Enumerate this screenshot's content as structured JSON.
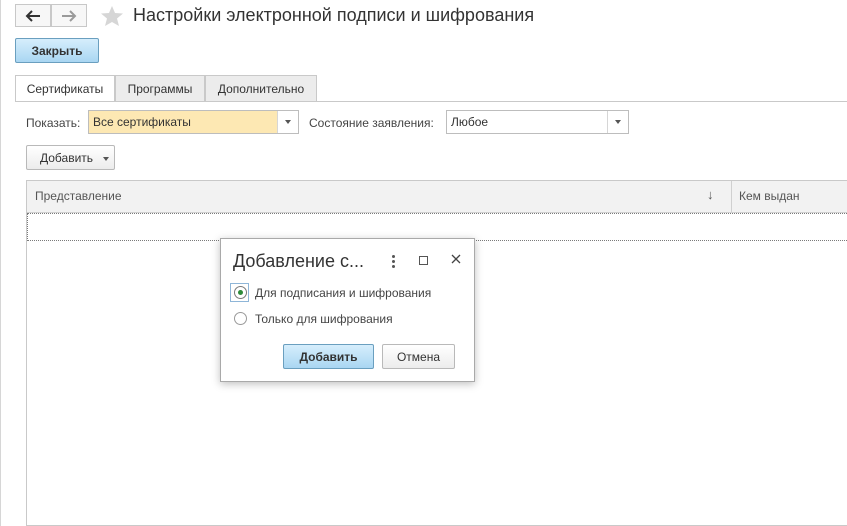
{
  "window": {
    "title": "Настройки электронной подписи и шифрования"
  },
  "toolbar": {
    "close_label": "Закрыть"
  },
  "tabs": [
    {
      "label": "Сертификаты",
      "active": true
    },
    {
      "label": "Программы",
      "active": false
    },
    {
      "label": "Дополнительно",
      "active": false
    }
  ],
  "filters": {
    "show_label": "Показать:",
    "show_value": "Все сертификаты",
    "status_label": "Состояние заявления:",
    "status_value": "Любое"
  },
  "actions": {
    "add_label": "Добавить"
  },
  "table": {
    "columns": [
      "Представление",
      "Кем выдан"
    ],
    "sort_indicator": "↓",
    "rows": []
  },
  "dialog": {
    "title": "Добавление с...",
    "options": [
      {
        "label": "Для подписания и шифрования",
        "selected": true
      },
      {
        "label": "Только для шифрования",
        "selected": false
      }
    ],
    "ok_label": "Добавить",
    "cancel_label": "Отмена"
  },
  "colors": {
    "primary_button": "#a9d6f2",
    "highlight_combo": "#fde8b3",
    "radio_selected": "#2e8b3a"
  },
  "icons": [
    "back-arrow-icon",
    "forward-arrow-icon",
    "favorite-star-icon",
    "dropdown-arrow-icon",
    "more-vertical-icon",
    "maximize-icon",
    "close-icon"
  ]
}
